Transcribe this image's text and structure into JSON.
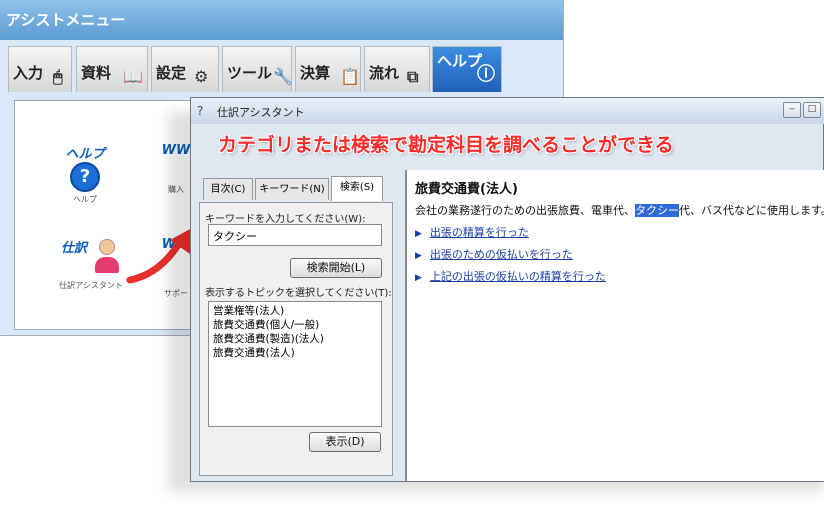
{
  "assist": {
    "title": "アシストメニュー",
    "tabs": [
      "入力",
      "資料",
      "設定",
      "ツール",
      "決算",
      "流れ",
      "ヘルプ"
    ],
    "items": [
      {
        "logo": "ヘルプ",
        "label": "ヘルプ"
      },
      {
        "logo": "仕訳",
        "label": "仕訳アシスタント"
      },
      {
        "partial1": "WW",
        "partial_label1": "購入"
      },
      {
        "partial2": "WW",
        "partial_label2": "サポー"
      }
    ]
  },
  "dialog": {
    "title": "仕訳アシスタント",
    "caption": "カテゴリまたは検索で勘定科目を調べることができる",
    "tabs": {
      "contents": "目次(C)",
      "keyword": "キーワード(N)",
      "search": "検索(S)"
    },
    "keyword_label": "キーワードを入力してください(W):",
    "keyword_value": "タクシー",
    "search_button": "検索開始(L)",
    "topic_label": "表示するトピックを選択してください(T):",
    "topics": [
      "営業権等(法人)",
      "旅費交通費(個人/一般)",
      "旅費交通費(製造)(法人)",
      "旅費交通費(法人)"
    ],
    "display_button": "表示(D)",
    "content": {
      "title": "旅費交通費(法人)",
      "desc_before": "会社の業務遂行のための出張旅費、電車代、",
      "desc_highlight": "タクシー",
      "desc_after": "代、バス代などに使用します。",
      "links": [
        "出張の精算を行った",
        "出張のための仮払いを行った",
        "上記の出張の仮払いの精算を行った"
      ]
    }
  },
  "colors": {
    "caption": "#ff2a2a",
    "accent": "#2f6ad9",
    "arrow": "#e8302a"
  }
}
